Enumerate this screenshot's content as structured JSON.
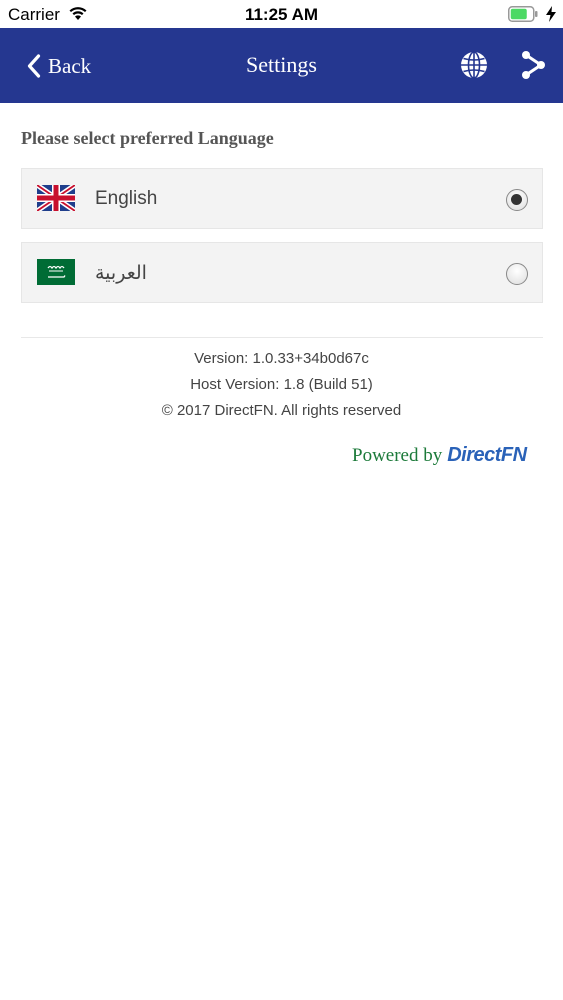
{
  "status_bar": {
    "carrier": "Carrier",
    "time": "11:25 AM",
    "battery_color": "#4cd964"
  },
  "nav": {
    "back_label": "Back",
    "title": "Settings",
    "background": "#253790",
    "icons": [
      "chevron-left-icon",
      "globe-icon",
      "share-icon"
    ]
  },
  "language": {
    "heading": "Please select preferred Language",
    "options": [
      {
        "label": "English",
        "flag": "uk-flag-icon",
        "selected": true
      },
      {
        "label": "العربية",
        "flag": "saudi-flag-icon",
        "selected": false
      }
    ]
  },
  "info": {
    "version": "Version: 1.0.33+34b0d67c",
    "host_version": "Host Version: 1.8 (Build 51)",
    "copyright": "© 2017 DirectFN. All rights reserved"
  },
  "footer": {
    "powered_by": "Powered by",
    "brand": "DirectFN",
    "powered_color": "#1c7a3a",
    "brand_color": "#2a62b8"
  }
}
